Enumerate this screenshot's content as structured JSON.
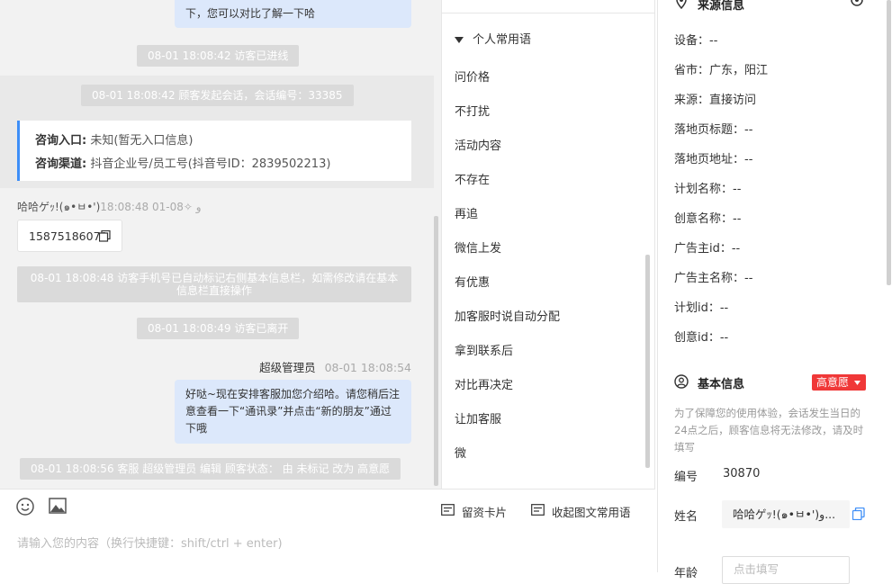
{
  "chat": {
    "top_bubble_text": "下，您可以对比了解一下哈",
    "sys1": "08-01 18:08:42 访客已进线",
    "sys2": "08-01 18:08:42 顾客发起会话，会话编号：33385",
    "consult": {
      "entry_label": "咨询入口:",
      "entry_value": "未知(暂无入口信息)",
      "channel_label": "咨询渠道:",
      "channel_value": "抖音企业号/员工号(抖音号ID：2839502213)"
    },
    "visitor_name": "哈哈ゲｯ!(๑•ㅂ•')",
    "visitor_time": "18:08:48 01-08✧ و",
    "visitor_phone": "15875186070",
    "sys3": "08-01 18:08:48 访客手机号已自动标记右侧基本信息栏，如需修改请在基本信息栏直接操作",
    "sys4": "08-01 18:08:49 访客已离开",
    "agent_name": "超级管理员",
    "agent_time": "08-01 18:08:54",
    "agent_message": "好哒~现在安排客服加您介绍哈。请您稍后注意查看一下“通讯录”并点击“新的朋友”通过下哦",
    "sys5": "08-01 18:08:56 客服 超级管理员 编辑 顾客状态： 由 未标记 改为 高意愿"
  },
  "phrases": {
    "group_title": "个人常用语",
    "items": [
      "问价格",
      "不打扰",
      "活动内容",
      "不存在",
      "再追",
      "微信上发",
      "有优惠",
      "加客服时说自动分配",
      "拿到联系后",
      "对比再决定",
      "让加客服",
      "微"
    ]
  },
  "composer": {
    "contact_card_label": "留资卡片",
    "collapse_label": "收起图文常用语",
    "input_placeholder": "请输入您的内容（换行快捷键：shift/ctrl + enter)"
  },
  "info": {
    "source_title": "来源信息",
    "device": "设备：--",
    "province": "省市：广东，阳江",
    "source": "来源：直接访问",
    "landing_title": "落地页标题：--",
    "landing_url": "落地页地址：--",
    "plan_name": "计划名称：--",
    "creative_name": "创意名称：--",
    "advertiser_id": "广告主id：--",
    "advertiser_name": "广告主名称：--",
    "plan_id": "计划id：--",
    "creative_id": "创意id：--",
    "basic_title": "基本信息",
    "intent_badge": "高意愿",
    "note": "为了保障您的使用体验，会话发生当日的24点之后，顾客信息将无法修改，请及时填写",
    "id_label": "编号",
    "id_value": "30870",
    "name_label": "姓名",
    "name_value": "哈哈ゲｯ!(๑•ㅂ•')و...",
    "age_label": "年龄",
    "age_placeholder": "点击填写"
  },
  "colors": {
    "accent": "#3e8ef7",
    "badge": "#f03838",
    "bubble": "#dce8fb"
  }
}
